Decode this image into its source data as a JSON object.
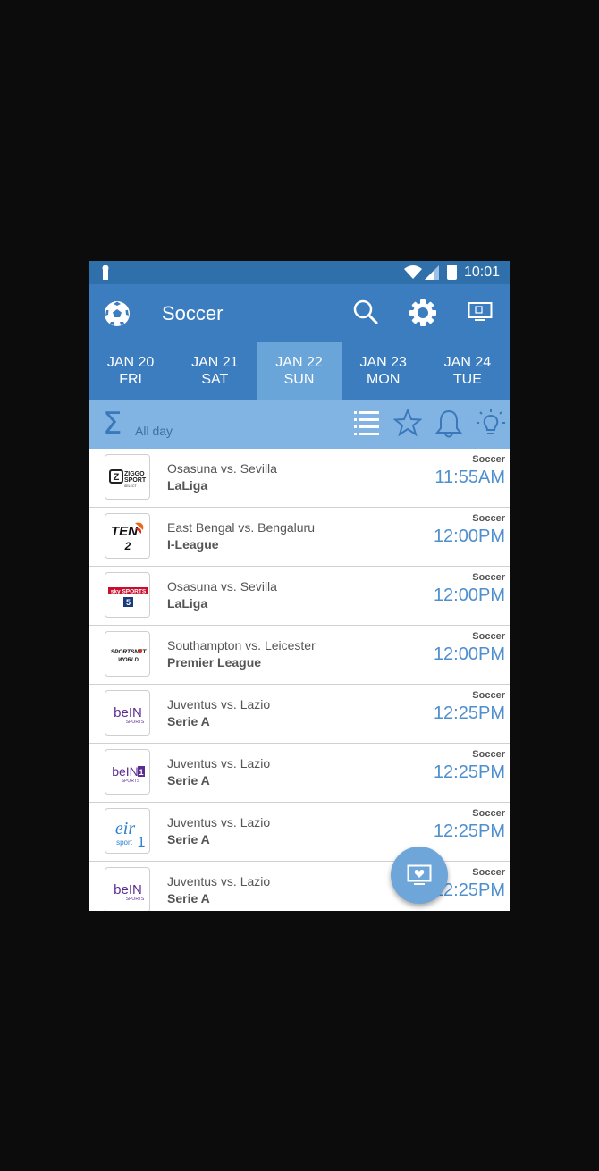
{
  "status_bar": {
    "time": "10:01"
  },
  "app_bar": {
    "title": "Soccer"
  },
  "dates": [
    {
      "date": "JAN 20",
      "day": "FRI"
    },
    {
      "date": "JAN 21",
      "day": "SAT"
    },
    {
      "date": "JAN 22",
      "day": "SUN",
      "active": true
    },
    {
      "date": "JAN 23",
      "day": "MON"
    },
    {
      "date": "JAN 24",
      "day": "TUE"
    }
  ],
  "filter": {
    "label": "All day"
  },
  "events": [
    {
      "channel_icon": "ziggo-sport-select-logo",
      "match": "Osasuna vs. Sevilla",
      "league": "LaLiga",
      "sport": "Soccer",
      "time": "11:55AM"
    },
    {
      "channel_icon": "ten-2-logo",
      "match": "East Bengal vs. Bengaluru",
      "league": "I-League",
      "sport": "Soccer",
      "time": "12:00PM"
    },
    {
      "channel_icon": "sky-sports-5-logo",
      "match": "Osasuna vs. Sevilla",
      "league": "LaLiga",
      "sport": "Soccer",
      "time": "12:00PM"
    },
    {
      "channel_icon": "sportsnet-world-logo",
      "match": "Southampton vs. Leicester",
      "league": "Premier League",
      "sport": "Soccer",
      "time": "12:00PM"
    },
    {
      "channel_icon": "bein-sports-logo",
      "match": "Juventus vs. Lazio",
      "league": "Serie A",
      "sport": "Soccer",
      "time": "12:25PM"
    },
    {
      "channel_icon": "bein-sports-1-logo",
      "match": "Juventus vs. Lazio",
      "league": "Serie A",
      "sport": "Soccer",
      "time": "12:25PM"
    },
    {
      "channel_icon": "eir-sport-1-logo",
      "match": "Juventus vs. Lazio",
      "league": "Serie A",
      "sport": "Soccer",
      "time": "12:25PM"
    },
    {
      "channel_icon": "bein-sports-logo",
      "match": "Juventus vs. Lazio",
      "league": "Serie A",
      "sport": "Soccer",
      "time": "12:25PM"
    }
  ],
  "logos": {
    "ziggo": {
      "line1": "ZIGGO",
      "line2": "SPORT",
      "line3": "SELECT"
    },
    "ten": {
      "brand": "TEN",
      "num": "2"
    },
    "sky": {
      "brand": "sky SPORTS",
      "num": "5"
    },
    "sportsnet": {
      "line1": "SPORTSNET",
      "line2": "WORLD"
    },
    "bein": {
      "brand": "beIN",
      "sub": "SPORTS",
      "num": "1"
    },
    "eir": {
      "brand": "eir",
      "sub": "sport",
      "num": "1"
    }
  },
  "colors": {
    "status_bar": "#2f6faa",
    "app_bar": "#3c7dbf",
    "active_tab": "#6aa5da",
    "filter_bar": "#82b4e3",
    "time_text": "#4f8fce"
  }
}
